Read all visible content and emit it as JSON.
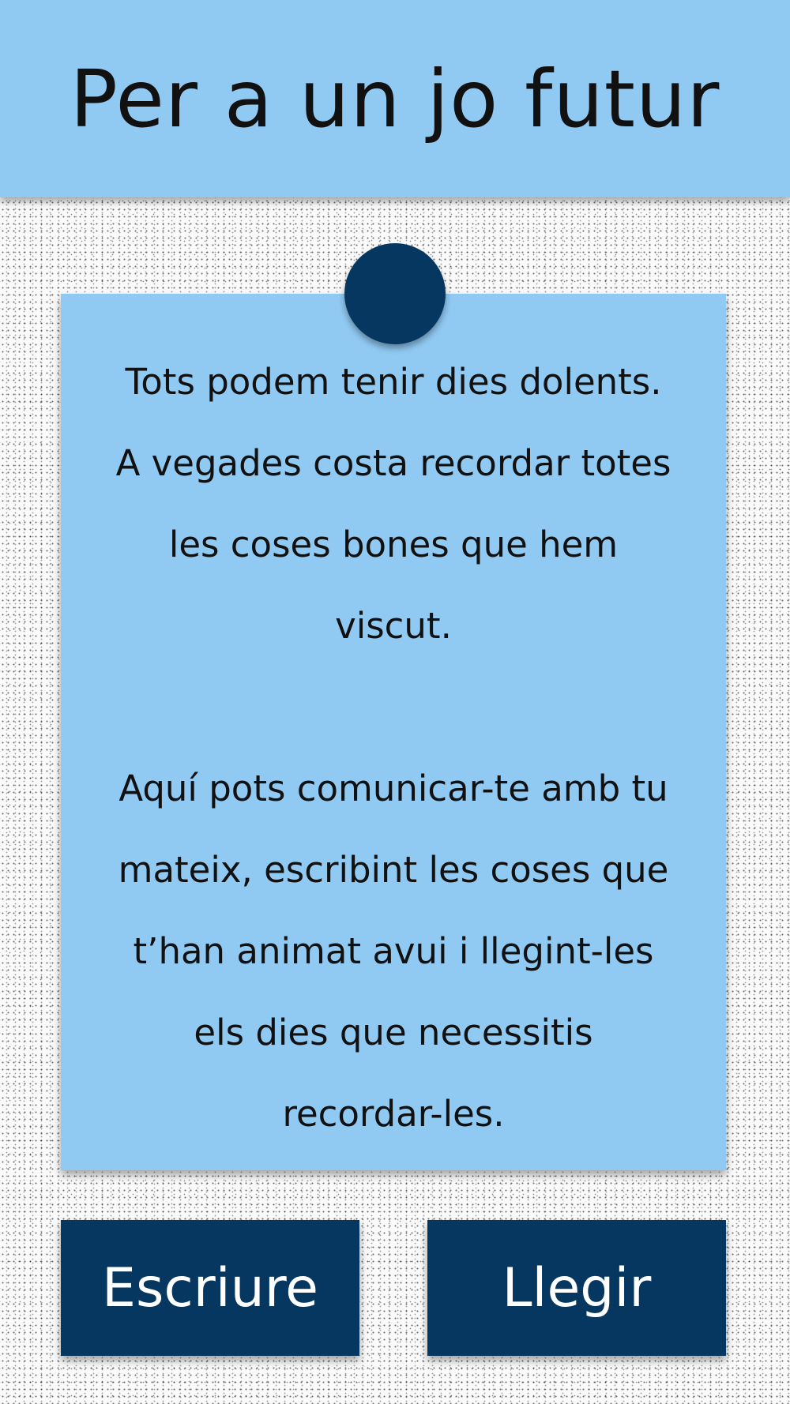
{
  "header": {
    "title": "Per a un jo futur"
  },
  "note": {
    "paragraph_1": "Tots podem tenir dies dolents. A vegades costa recordar totes les coses bones que hem viscut.",
    "paragraph_2": "Aquí pots comunicar-te amb tu mateix, escribint les coses que t’han animat avui i llegint-les els dies que necessitis recordar-les."
  },
  "actions": {
    "write_label": "Escriure",
    "read_label": "Llegir"
  },
  "colors": {
    "light_blue": "#90c9f2",
    "navy": "#063761",
    "background": "#fafafa"
  }
}
